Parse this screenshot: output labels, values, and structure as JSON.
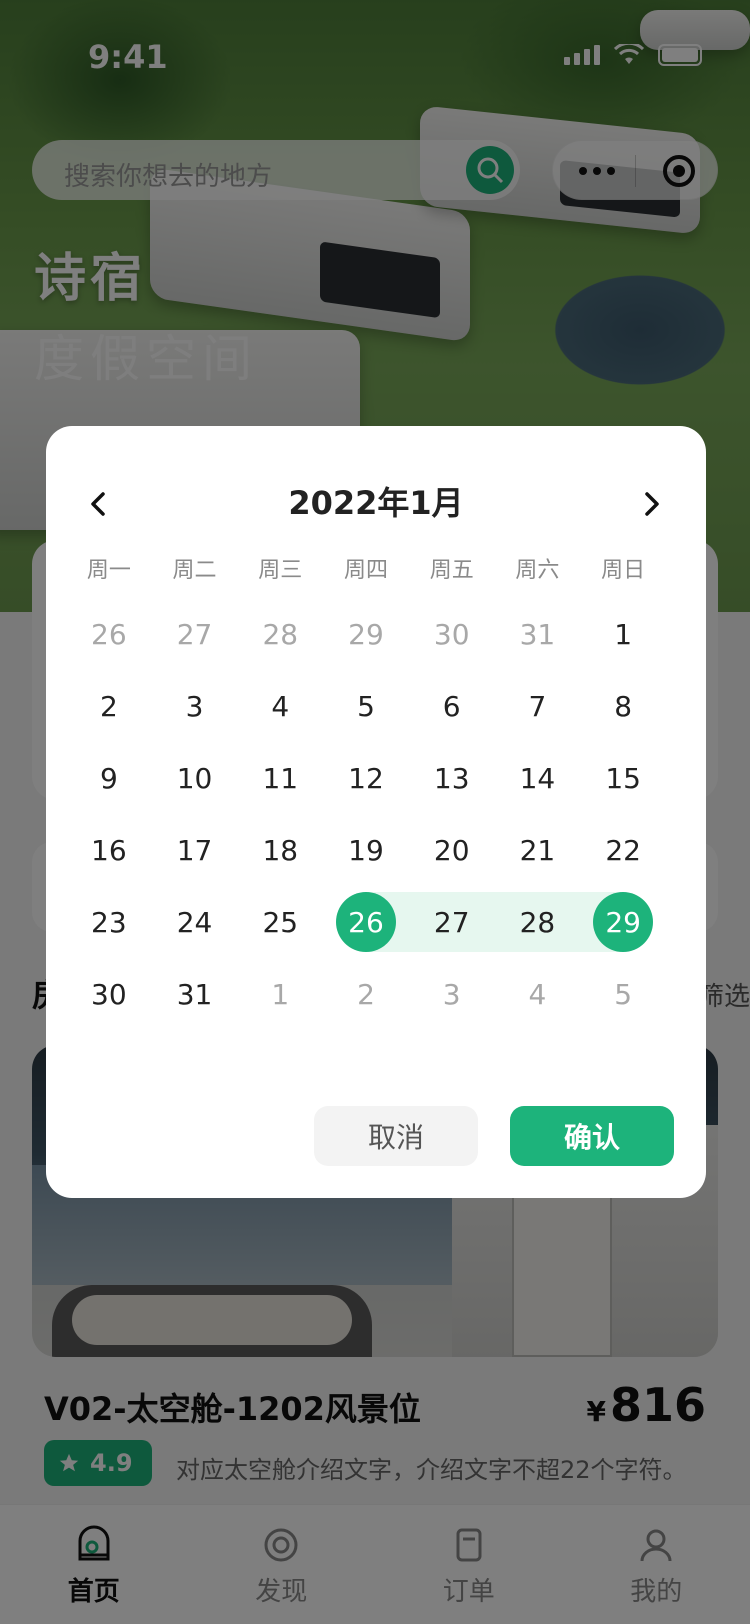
{
  "status": {
    "time": "9:41"
  },
  "search": {
    "placeholder": "搜索你想去的地方"
  },
  "brand": {
    "title": "诗宿",
    "subtitle": "度假空间"
  },
  "section": {
    "title": "房",
    "filter": "里筛选"
  },
  "listing": {
    "name": "V02-太空舱-1202风景位",
    "currency": "¥",
    "price": "816",
    "rating": "4.9",
    "description": "对应太空舱介绍文字，介绍文字不超22个字符。"
  },
  "tabbar": {
    "items": [
      {
        "label": "首页",
        "icon": "home-icon",
        "active": true
      },
      {
        "label": "发现",
        "icon": "compass-icon",
        "active": false
      },
      {
        "label": "订单",
        "icon": "order-icon",
        "active": false
      },
      {
        "label": "我的",
        "icon": "user-icon",
        "active": false
      }
    ]
  },
  "calendar": {
    "title": "2022年1月",
    "weekdays": [
      "周一",
      "周二",
      "周三",
      "周四",
      "周五",
      "周六",
      "周日"
    ],
    "weeks": [
      [
        "26",
        "27",
        "28",
        "29",
        "30",
        "31",
        "1"
      ],
      [
        "2",
        "3",
        "4",
        "5",
        "6",
        "7",
        "8"
      ],
      [
        "9",
        "10",
        "11",
        "12",
        "13",
        "14",
        "15"
      ],
      [
        "16",
        "17",
        "18",
        "19",
        "20",
        "21",
        "22"
      ],
      [
        "23",
        "24",
        "25",
        "26",
        "27",
        "28",
        "29"
      ],
      [
        "30",
        "31",
        "1",
        "2",
        "3",
        "4",
        "5"
      ]
    ],
    "selected_start": "26",
    "selected_end": "29",
    "cancel_label": "取消",
    "confirm_label": "确认"
  },
  "colors": {
    "accent": "#1db37b",
    "range_bg": "#e6f7ef"
  }
}
